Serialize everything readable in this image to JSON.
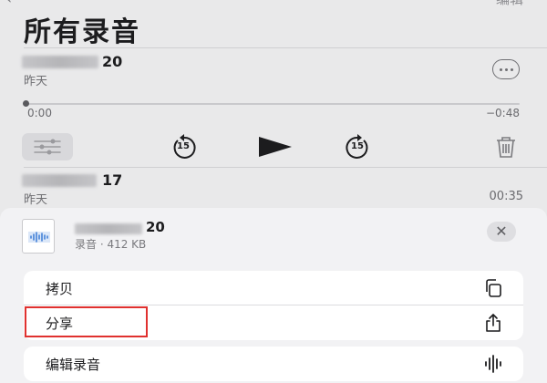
{
  "header": {
    "title": "所有录音"
  },
  "recordings": [
    {
      "name_suffix": "20",
      "date": "昨天",
      "elapsed": "0:00",
      "remaining": "−0:48"
    },
    {
      "name_suffix": "17",
      "date": "昨天",
      "duration": "00:35"
    }
  ],
  "player": {
    "skip_back_seconds": "15",
    "skip_forward_seconds": "15"
  },
  "sheet": {
    "file_name_suffix": "20",
    "file_meta": "录音 · 412 KB",
    "close_glyph": "✕",
    "actions": [
      {
        "label": "拷贝",
        "icon": "copy-icon"
      },
      {
        "label": "分享",
        "icon": "share-icon"
      },
      {
        "label": "编辑录音",
        "icon": "waveform-icon"
      }
    ]
  },
  "colors": {
    "background": "#e9e9ea",
    "sheet": "#f2f2f4",
    "highlight": "#e0312f"
  }
}
